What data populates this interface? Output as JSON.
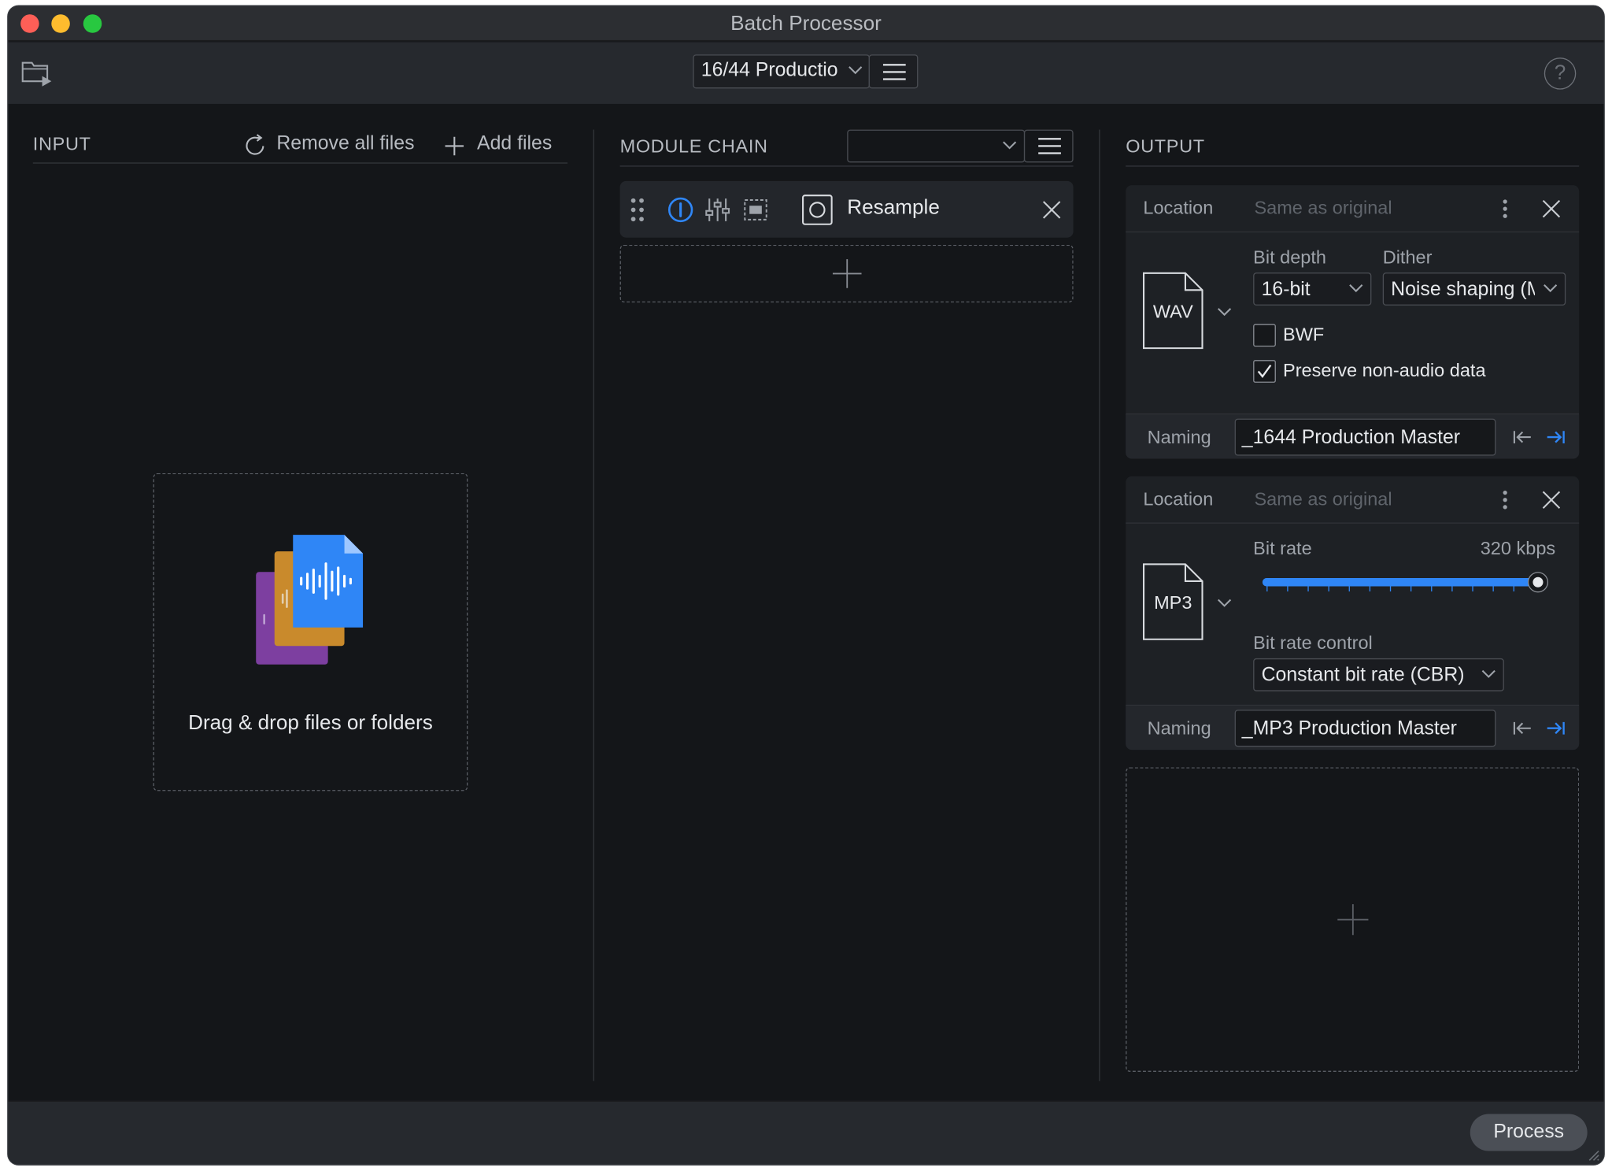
{
  "window": {
    "title": "Batch Processor"
  },
  "toolbar": {
    "preset_label": "16/44 Productio",
    "help_label": "?"
  },
  "input": {
    "header": "INPUT",
    "remove_all_label": "Remove all files",
    "add_files_label": "Add files",
    "drop_label": "Drag & drop files or folders"
  },
  "module_chain": {
    "header": "MODULE CHAIN",
    "preset_value": "",
    "modules": [
      {
        "name": "Resample"
      }
    ]
  },
  "output": {
    "header": "OUTPUT",
    "cards": [
      {
        "location_label": "Location",
        "location_value": "Same as original",
        "format": "WAV",
        "bit_depth_label": "Bit depth",
        "bit_depth_value": "16-bit",
        "dither_label": "Dither",
        "dither_value": "Noise shaping (M",
        "bwf_label": "BWF",
        "bwf_checked": false,
        "preserve_label": "Preserve non-audio data",
        "preserve_checked": true,
        "naming_label": "Naming",
        "naming_value": "_1644 Production Master"
      },
      {
        "location_label": "Location",
        "location_value": "Same as original",
        "format": "MP3",
        "bit_rate_label": "Bit rate",
        "bit_rate_value": "320 kbps",
        "bit_rate_fraction": 1.0,
        "bit_rate_control_label": "Bit rate control",
        "bit_rate_control_value": "Constant bit rate (CBR)",
        "naming_label": "Naming",
        "naming_value": "_MP3 Production Master"
      }
    ]
  },
  "footer": {
    "process_label": "Process"
  },
  "colors": {
    "accent": "#2f86f6",
    "background": "#141619",
    "panel": "#1e2125"
  }
}
